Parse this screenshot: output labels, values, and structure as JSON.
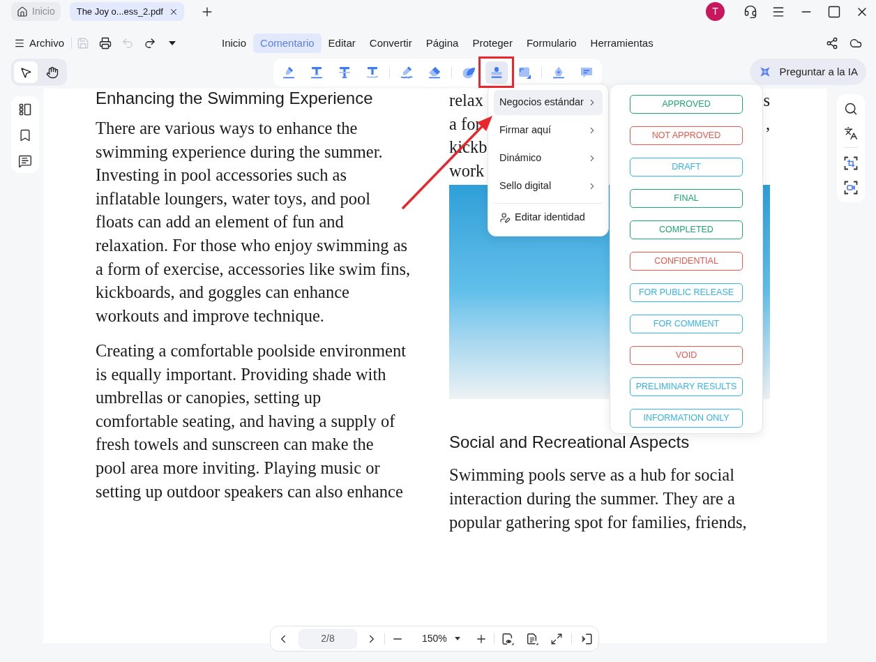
{
  "tabs": [
    {
      "kind": "home",
      "label": "Inicio",
      "selected": false
    },
    {
      "kind": "document",
      "label": "The Joy o...ess_2.pdf",
      "selected": true
    }
  ],
  "account": {
    "initial": "T"
  },
  "window_controls": [
    {
      "kind": "support"
    },
    {
      "kind": "menu"
    },
    {
      "kind": "minimize"
    },
    {
      "kind": "maximize"
    },
    {
      "kind": "close"
    }
  ],
  "file_menu": {
    "label": "Archivo"
  },
  "quick_actions": [
    {
      "kind": "save",
      "disabled": true
    },
    {
      "kind": "print",
      "disabled": false
    },
    {
      "kind": "undo",
      "disabled": true
    },
    {
      "kind": "redo",
      "disabled": false
    },
    {
      "kind": "dropdown",
      "disabled": false
    }
  ],
  "ribbon_tabs": [
    {
      "label": "Inicio",
      "selected": false
    },
    {
      "label": "Comentario",
      "selected": true
    },
    {
      "label": "Editar",
      "selected": false
    },
    {
      "label": "Convertir",
      "selected": false
    },
    {
      "label": "Página",
      "selected": false
    },
    {
      "label": "Proteger",
      "selected": false
    },
    {
      "label": "Formulario",
      "selected": false
    },
    {
      "label": "Herramientas",
      "selected": false
    }
  ],
  "ribbon_actions": [
    {
      "kind": "share"
    },
    {
      "kind": "cloud"
    }
  ],
  "tool_modes": [
    {
      "kind": "select",
      "selected": true
    },
    {
      "kind": "hand",
      "selected": false
    }
  ],
  "comment_tool_groups": [
    {
      "tools": [
        {
          "kind": "highlight",
          "selected": false
        },
        {
          "kind": "textbox",
          "selected": false
        },
        {
          "kind": "strikethrough",
          "selected": false
        },
        {
          "kind": "underline",
          "selected": false
        }
      ]
    },
    {
      "tools": [
        {
          "kind": "pencil",
          "selected": false
        },
        {
          "kind": "eraser",
          "selected": false
        }
      ]
    },
    {
      "tools": [
        {
          "kind": "shape",
          "selected": false
        },
        {
          "kind": "stamp",
          "selected": true
        },
        {
          "kind": "area",
          "selected": false
        }
      ]
    },
    {
      "tools": [
        {
          "kind": "signature",
          "selected": false
        },
        {
          "kind": "note",
          "selected": false
        }
      ]
    }
  ],
  "ai_button": {
    "label": "Preguntar a la IA"
  },
  "left_panel": [
    {
      "kind": "thumbnails"
    },
    {
      "kind": "bookmarks"
    },
    {
      "kind": "comments"
    }
  ],
  "right_panel_groups": [
    {
      "tools": [
        {
          "kind": "search"
        },
        {
          "kind": "translate"
        }
      ]
    },
    {
      "tools": [
        {
          "kind": "crop"
        },
        {
          "kind": "capture"
        }
      ]
    }
  ],
  "document": {
    "left_column": {
      "heading": "Enhancing the Swimming Experience",
      "paragraphs": [
        {
          "lines": [
            "There are various ways to enhance the",
            "swimming experience during the summer.",
            "Investing in pool accessories such as",
            "inflatable loungers, water toys, and pool",
            "floats can add an element of fun and",
            "relaxation. For those who enjoy swimming as",
            "a form of exercise, accessories like swim fins,",
            "kickboards, and goggles can enhance",
            "workouts and improve technique."
          ]
        },
        {
          "lines": [
            "Creating a comfortable poolside environment",
            "is equally important. Providing shade with",
            "umbrellas or canopies, setting up",
            "comfortable seating, and having a supply of",
            "fresh towels and sunscreen can make the",
            "pool area more inviting. Playing music or",
            "setting up outdoor speakers can also enhance"
          ]
        }
      ]
    },
    "right_column": {
      "covered_lines": [
        {
          "start": "relax",
          "end": "s"
        },
        {
          "start": "a for",
          "end": ","
        },
        {
          "start": "kickb"
        },
        {
          "start": "work"
        }
      ],
      "photo": {
        "kind": "photo"
      },
      "heading": "Social and Recreational Aspects",
      "paragraphs": [
        {
          "lines": [
            "Swimming pools serve as a hub for social",
            "interaction during the summer. They are a",
            "popular gathering spot for families, friends,"
          ]
        }
      ]
    }
  },
  "stamp_menu": {
    "categories": [
      {
        "kind": "submenu",
        "label": "Negocios estándar",
        "selected": true
      },
      {
        "kind": "submenu",
        "label": "Firmar aquí",
        "selected": false
      },
      {
        "kind": "submenu",
        "label": "Dinámico",
        "selected": false
      },
      {
        "kind": "submenu",
        "label": "Sello digital",
        "selected": false
      },
      {
        "kind": "action",
        "label": "Editar identidad",
        "selected": false
      }
    ],
    "stamps": [
      {
        "label": "APPROVED",
        "color": "#1aa96e"
      },
      {
        "label": "NOT APPROVED",
        "color": "#f2554b"
      },
      {
        "label": "DRAFT",
        "color": "#33b4ef"
      },
      {
        "label": "FINAL",
        "color": "#1aa96e"
      },
      {
        "label": "COMPLETED",
        "color": "#1aa96e"
      },
      {
        "label": "CONFIDENTIAL",
        "color": "#f2554b"
      },
      {
        "label": "FOR PUBLIC RELEASE",
        "color": "#33b4ef"
      },
      {
        "label": "FOR COMMENT",
        "color": "#33b4ef"
      },
      {
        "label": "VOID",
        "color": "#f2554b"
      },
      {
        "label": "PRELIMINARY RESULTS",
        "color": "#33b4ef"
      },
      {
        "label": "INFORMATION ONLY",
        "color": "#33b4ef"
      }
    ]
  },
  "page_navigation": {
    "page": "2/8",
    "zoom": "150%",
    "tools": [
      {
        "kind": "view_mode"
      },
      {
        "kind": "page_mode"
      },
      {
        "kind": "fullscreen"
      },
      {
        "kind": "exit"
      }
    ]
  },
  "annotations": {
    "highlight_box": true,
    "arrow": true
  }
}
